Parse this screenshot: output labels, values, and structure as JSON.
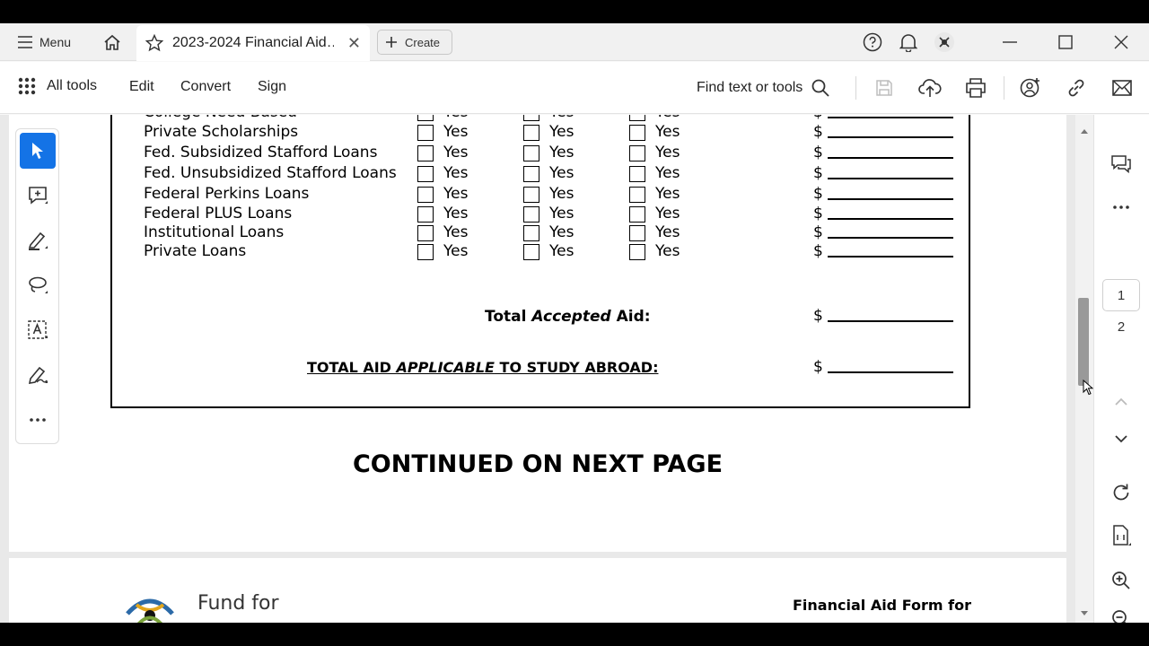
{
  "tabbar": {
    "menu_label": "Menu",
    "tab_title": "2023-2024 Financial Aid…",
    "create_label": "Create"
  },
  "toolbar": {
    "all_tools": "All tools",
    "edit": "Edit",
    "convert": "Convert",
    "sign": "Sign",
    "find": "Find text or tools"
  },
  "form": {
    "yes_label": "Yes",
    "dollar": "$",
    "rows": [
      {
        "label": "College Need-Based"
      },
      {
        "label": "Private Scholarships"
      },
      {
        "label": "Fed. Subsidized Stafford Loans"
      },
      {
        "label": "Fed. Unsubsidized Stafford Loans"
      },
      {
        "label": "Federal Perkins Loans"
      },
      {
        "label": "Federal PLUS Loans"
      },
      {
        "label": "Institutional Loans"
      },
      {
        "label": "Private Loans"
      }
    ],
    "total_accepted_pre": "Total ",
    "total_accepted_em": "Accepted",
    "total_accepted_post": " Aid:",
    "total_applicable_pre": "TOTAL AID ",
    "total_applicable_em": "APPLICABLE",
    "total_applicable_post": " TO STUDY ABROAD:",
    "continued": "CONTINUED ON NEXT PAGE"
  },
  "page2": {
    "org_name": "Fund for",
    "heading": "Financial Aid Form for"
  },
  "navigator": {
    "current_page": "1",
    "total_pages": "2"
  },
  "colors": {
    "accent": "#1473e6"
  }
}
